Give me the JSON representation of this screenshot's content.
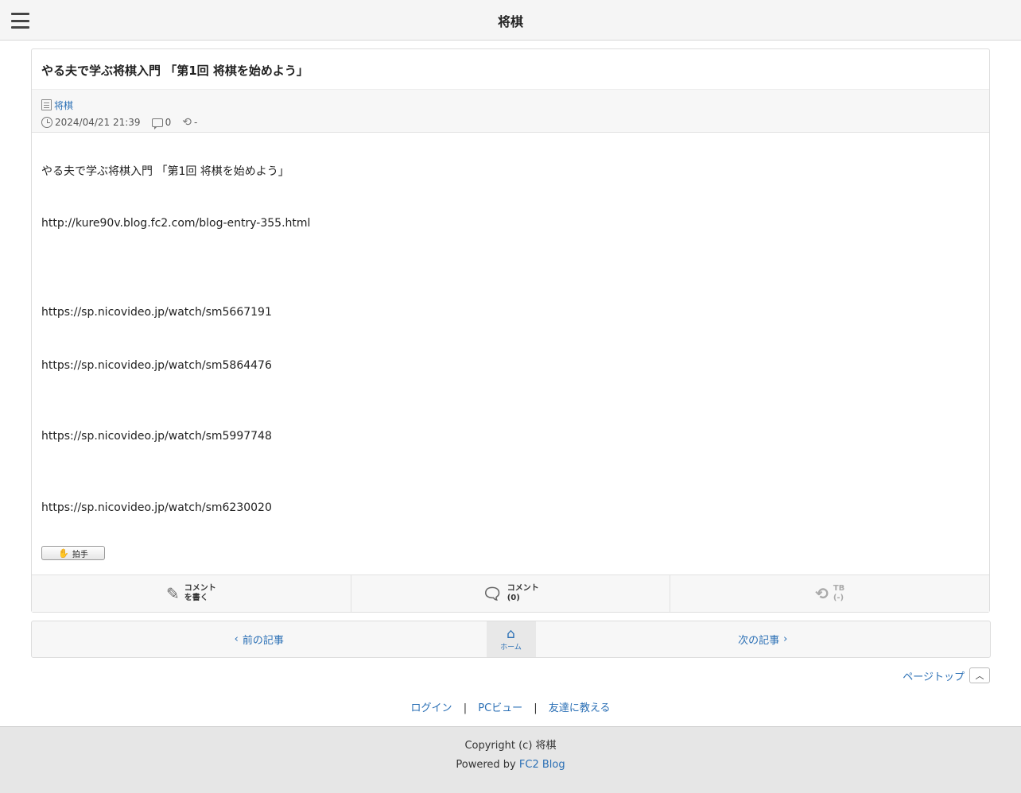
{
  "header": {
    "title": "将棋"
  },
  "article": {
    "title": "やる夫で学ぶ将棋入門 「第1回 将棋を始めよう」",
    "category": "将棋",
    "datetime": "2024/04/21 21:39",
    "comment_count": "0",
    "trackback_count": "-",
    "body": [
      "やる夫で学ぶ将棋入門 「第1回 将棋を始めよう」",
      "http://kure90v.blog.fc2.com/blog-entry-355.html",
      "https://sp.nicovideo.jp/watch/sm5667191",
      "https://sp.nicovideo.jp/watch/sm5864476",
      "https://sp.nicovideo.jp/watch/sm5997748",
      "https://sp.nicovideo.jp/watch/sm6230020"
    ],
    "clap_label": "拍手"
  },
  "actions": {
    "write_comment_line1": "コメント",
    "write_comment_line2": "を書く",
    "comments_line1": "コメント",
    "comments_line2": "(0)",
    "tb_line1": "TB",
    "tb_line2": "(-)"
  },
  "pager": {
    "prev": "前の記事",
    "home": "ホーム",
    "next": "次の記事"
  },
  "pagetop": "ページトップ",
  "footer_links": [
    "ログイン",
    "PCビュー",
    "友達に教える"
  ],
  "footer": {
    "copyright": "Copyright (c) 将棋",
    "powered_prefix": "Powered by",
    "powered_link": "FC2 Blog"
  }
}
